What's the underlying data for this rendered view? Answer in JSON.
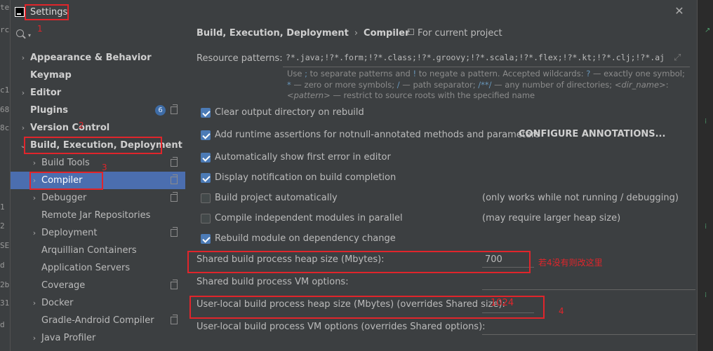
{
  "background": {
    "left_fragments": [
      "te",
      "rc",
      "c1",
      "68",
      "8c",
      "1",
      "2",
      "SE",
      "d",
      "2b",
      "31",
      "d"
    ]
  },
  "dialog": {
    "title": "Settings",
    "close_icon": "close-icon"
  },
  "annotations": {
    "n1": "1",
    "n2": "2",
    "n3": "3",
    "n4": "4",
    "note4": "若4没有则改这里",
    "color": "#e0252b"
  },
  "sidebar": {
    "search_icon": "search-icon",
    "items": [
      {
        "label": "Appearance & Behavior",
        "arrow": "›",
        "bold": true
      },
      {
        "label": "Keymap",
        "arrow": "",
        "bold": true
      },
      {
        "label": "Editor",
        "arrow": "›",
        "bold": true
      },
      {
        "label": "Plugins",
        "arrow": "",
        "bold": true,
        "badge": "6"
      },
      {
        "label": "Version Control",
        "arrow": "›",
        "bold": true
      },
      {
        "label": "Build, Execution, Deployment",
        "arrow": "⌄",
        "bold": true
      },
      {
        "label": "Build Tools",
        "arrow": "›"
      },
      {
        "label": "Compiler",
        "arrow": "›",
        "selected": true
      },
      {
        "label": "Debugger",
        "arrow": "›"
      },
      {
        "label": "Remote Jar Repositories",
        "arrow": ""
      },
      {
        "label": "Deployment",
        "arrow": "›"
      },
      {
        "label": "Arquillian Containers",
        "arrow": ""
      },
      {
        "label": "Application Servers",
        "arrow": ""
      },
      {
        "label": "Coverage",
        "arrow": ""
      },
      {
        "label": "Docker",
        "arrow": "›"
      },
      {
        "label": "Gradle-Android Compiler",
        "arrow": ""
      },
      {
        "label": "Java Profiler",
        "arrow": "›"
      }
    ]
  },
  "content": {
    "breadcrumb": [
      "Build, Execution, Deployment",
      "Compiler"
    ],
    "breadcrumb_sep": "›",
    "for_project": "For current project",
    "resource_patterns": {
      "label": "Resource patterns:",
      "value": "?*.java;!?*.form;!?*.class;!?*.groovy;!?*.scala;!?*.flex;!?*.kt;!?*.clj;!?*.aj",
      "help": {
        "p1": "Use ",
        "sym1": ";",
        "p2": " to separate patterns and ",
        "sym2": "!",
        "p3": " to negate a pattern. Accepted wildcards: ",
        "sym3": "?",
        "p4": " — exactly one symbol; ",
        "sym4": "*",
        "p5": " — zero or more symbols; ",
        "sym5": "/",
        "p6": " — path separator; ",
        "sym6": "/**/",
        "p7": " — any number of directories; ",
        "em1": "<dir_name>",
        "p8": ":",
        "em2": "<pattern>",
        "p9": " — restrict to source roots with the specified name"
      }
    },
    "checks": [
      {
        "label": "Clear output directory on rebuild",
        "checked": true
      },
      {
        "label": "Add runtime assertions for notnull-annotated methods and parameters",
        "checked": true
      },
      {
        "label": "Automatically show first error in editor",
        "checked": true
      },
      {
        "label": "Display notification on build completion",
        "checked": true
      },
      {
        "label": "Build project automatically",
        "checked": false,
        "note": "(only works while not running / debugging)"
      },
      {
        "label": "Compile independent modules in parallel",
        "checked": false,
        "note": "(may require larger heap size)"
      },
      {
        "label": "Rebuild module on dependency change",
        "checked": true
      }
    ],
    "configure_annotations": "CONFIGURE ANNOTATIONS...",
    "shared_heap": {
      "label": "Shared build process heap size (Mbytes):",
      "value": "700"
    },
    "shared_vm": {
      "label": "Shared build process VM options:",
      "value": ""
    },
    "user_heap": {
      "label": "User-local build process heap size (Mbytes) (overrides Shared size):",
      "value": "1024"
    },
    "user_vm": {
      "label": "User-local build process VM options (overrides Shared options):",
      "value": ""
    }
  }
}
